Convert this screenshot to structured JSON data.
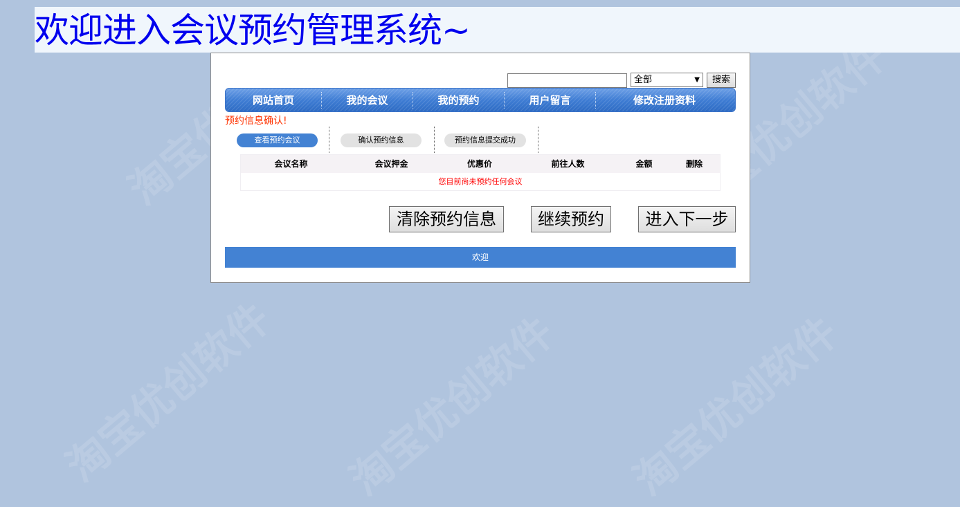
{
  "banner": {
    "title": "欢迎进入会议预约管理系统~"
  },
  "search": {
    "input_value": "",
    "select_value": "全部",
    "button_label": "搜索"
  },
  "nav": {
    "items": [
      "网站首页",
      "我的会议",
      "我的预约",
      "用户留言",
      "修改注册资料"
    ]
  },
  "confirm": {
    "title": "预约信息确认!"
  },
  "steps": [
    {
      "label": "查看预约会议",
      "active": true
    },
    {
      "label": "确认预约信息",
      "active": false
    },
    {
      "label": "预约信息提交成功",
      "active": false
    }
  ],
  "table": {
    "headers": [
      "会议名称",
      "会议押金",
      "优惠价",
      "前往人数",
      "金额",
      "删除"
    ],
    "empty_message": "您目前尚未预约任何会议"
  },
  "buttons": {
    "clear": "清除预约信息",
    "continue": "继续预约",
    "next": "进入下一步"
  },
  "footer": {
    "text": "欢迎"
  },
  "watermark": {
    "text": "淘宝优创软件"
  },
  "colors": {
    "background": "#b0c4de",
    "accent": "#4382d3",
    "banner_text": "#0000ee",
    "alert": "#ff3300"
  }
}
